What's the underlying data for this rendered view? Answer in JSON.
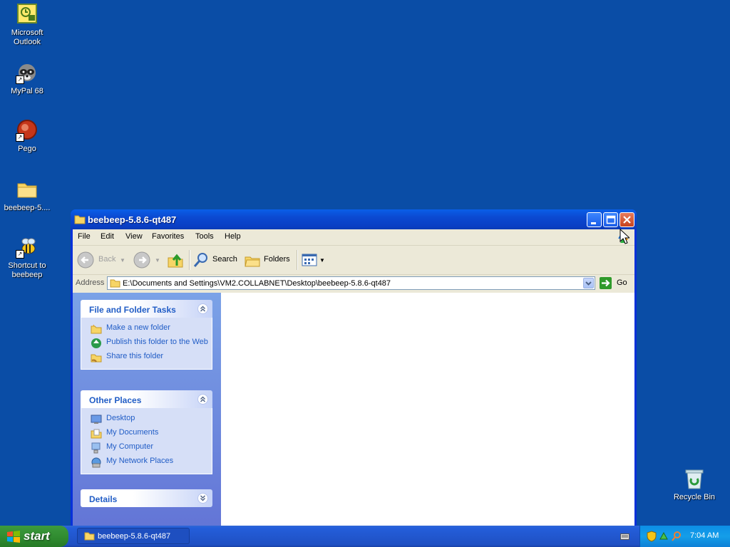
{
  "desktop": {
    "icons": [
      {
        "label": "Microsoft Outlook"
      },
      {
        "label": "MyPal 68"
      },
      {
        "label": "Pego"
      },
      {
        "label": "beebeep-5...."
      },
      {
        "label": "Shortcut to beebeep"
      },
      {
        "label": "Recycle Bin"
      }
    ]
  },
  "window": {
    "title": "beebeep-5.8.6-qt487",
    "menu": [
      "File",
      "Edit",
      "View",
      "Favorites",
      "Tools",
      "Help"
    ],
    "toolbar": {
      "back_label": "Back",
      "search_label": "Search",
      "folders_label": "Folders"
    },
    "address": {
      "label": "Address",
      "value": "E:\\Documents and Settings\\VM2.COLLABNET\\Desktop\\beebeep-5.8.6-qt487",
      "go_label": "Go"
    },
    "taskpane": {
      "file_tasks": {
        "title": "File and Folder Tasks",
        "items": [
          "Make a new folder",
          "Publish this folder to the Web",
          "Share this folder"
        ]
      },
      "other_places": {
        "title": "Other Places",
        "items": [
          "Desktop",
          "My Documents",
          "My Computer",
          "My Network Places"
        ]
      },
      "details": {
        "title": "Details"
      }
    }
  },
  "taskbar": {
    "start_label": "start",
    "task_item": "beebeep-5.8.6-qt487",
    "clock": "7:04 AM"
  },
  "colors": {
    "desktop": "#0a4da6",
    "link": "#215dc6",
    "taskbar": "#245edb",
    "start": "#2f8a2f"
  }
}
